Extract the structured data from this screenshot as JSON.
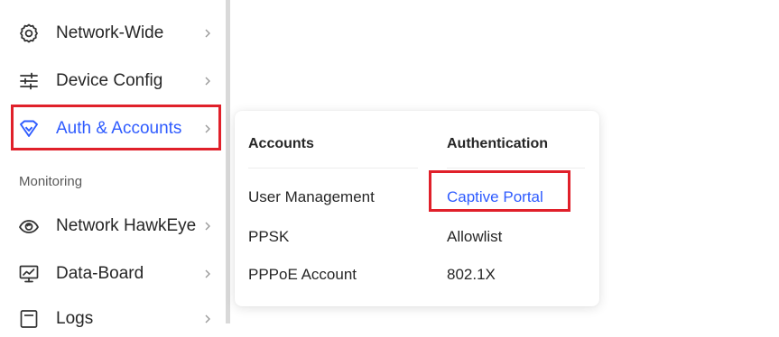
{
  "sidebar": {
    "items": [
      {
        "label": "Network-Wide",
        "icon": "gear-icon"
      },
      {
        "label": "Device Config",
        "icon": "sliders-icon"
      },
      {
        "label": "Auth & Accounts",
        "icon": "shield-heart-icon",
        "active": true
      }
    ],
    "section_label": "Monitoring",
    "monitoring_items": [
      {
        "label": "Network HawkEye",
        "icon": "eye-icon"
      },
      {
        "label": "Data-Board",
        "icon": "dashboard-monitor-icon"
      },
      {
        "label": "Logs",
        "icon": "log-icon"
      }
    ]
  },
  "flyout": {
    "accounts": {
      "heading": "Accounts",
      "links": [
        "User Management",
        "PPSK",
        "PPPoE Account"
      ]
    },
    "authentication": {
      "heading": "Authentication",
      "links": [
        "Captive Portal",
        "Allowlist",
        "802.1X"
      ]
    }
  },
  "colors": {
    "accent": "#2e5bff",
    "highlight_box": "#e0202a",
    "text": "#262626",
    "muted": "#595959"
  }
}
